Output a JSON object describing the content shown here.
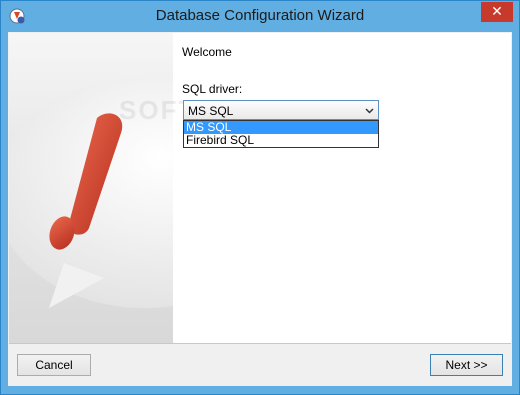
{
  "window": {
    "title": "Database Configuration Wizard",
    "close_glyph": "✕",
    "icon": "app-wizard-icon"
  },
  "content": {
    "welcome": "Welcome",
    "driver_label": "SQL driver:",
    "driver_selected": "MS SQL",
    "driver_options": [
      "MS SQL",
      "Firebird SQL"
    ],
    "watermark": "SOFTPEDIA"
  },
  "footer": {
    "cancel_label": "Cancel",
    "next_label": "Next >>"
  },
  "colors": {
    "titlebar": "#61aee3",
    "selection": "#3399ff",
    "close_button": "#c7392b",
    "exclamation_red": "#d8452b"
  }
}
